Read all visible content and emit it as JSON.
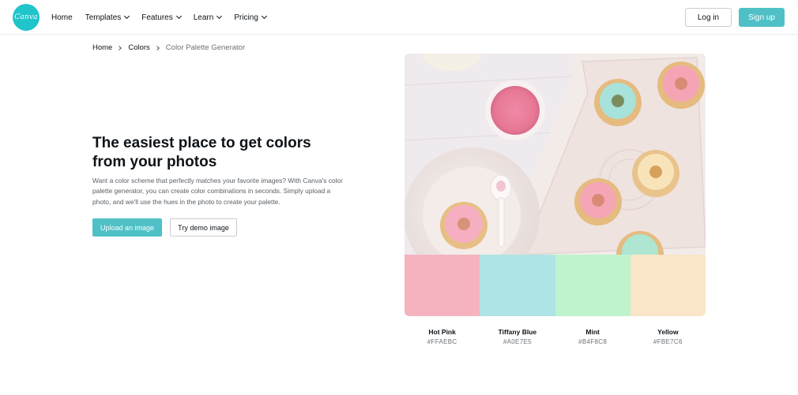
{
  "logo": {
    "text": "Canva",
    "color": "#20c4cb"
  },
  "nav": {
    "items": [
      {
        "label": "Home",
        "dropdown": false
      },
      {
        "label": "Templates",
        "dropdown": true
      },
      {
        "label": "Features",
        "dropdown": true
      },
      {
        "label": "Learn",
        "dropdown": true
      },
      {
        "label": "Pricing",
        "dropdown": true
      }
    ]
  },
  "auth": {
    "login_label": "Log in",
    "signup_label": "Sign up"
  },
  "breadcrumb": {
    "home": "Home",
    "colors": "Colors",
    "current": "Color Palette Generator"
  },
  "hero": {
    "title": "The easiest place to get colors from your photos",
    "description": "Want a color scheme that perfectly matches your favorite images? With Canva's color palette generator, you can create color combinations in seconds. Simply upload a photo, and we'll use the hues in the photo to create your palette.",
    "upload_label": "Upload an image",
    "demo_label": "Try demo image"
  },
  "palette": [
    {
      "name": "Hot Pink",
      "hex": "#FFAEBC",
      "swatch": "#f5b3bf"
    },
    {
      "name": "Tiffany Blue",
      "hex": "#A0E7E5",
      "swatch": "#aee4e5"
    },
    {
      "name": "Mint",
      "hex": "#B4F8C8",
      "swatch": "#bef3ce"
    },
    {
      "name": "Yellow",
      "hex": "#FBE7C6",
      "swatch": "#f9e5c7"
    }
  ],
  "accent": "#4fc1c6"
}
